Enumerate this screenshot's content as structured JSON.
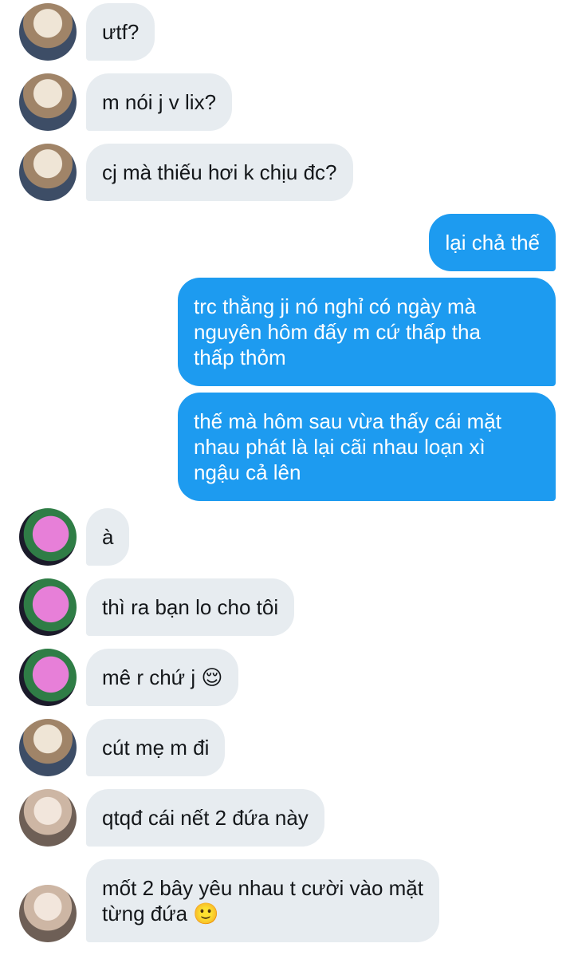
{
  "messages": [
    {
      "text": "ưtf?",
      "direction": "received",
      "sender_avatar": "avatar-a"
    },
    {
      "text": "m nói j v lix?",
      "direction": "received",
      "sender_avatar": "avatar-a"
    },
    {
      "text": "cj mà thiếu hơi k chịu đc?",
      "direction": "received",
      "sender_avatar": "avatar-a"
    },
    {
      "text": "lại chả thế",
      "direction": "sent"
    },
    {
      "text": "trc thằng ji nó nghỉ có ngày mà\nnguyên hôm đấy m cứ thấp tha\nthấp thỏm",
      "direction": "sent"
    },
    {
      "text": "thế mà hôm sau vừa thấy cái mặt\nnhau phát là lại cãi nhau loạn xì\nngậu cả lên",
      "direction": "sent"
    },
    {
      "text": "à",
      "direction": "received",
      "sender_avatar": "avatar-b"
    },
    {
      "text": "thì ra bạn lo cho tôi",
      "direction": "received",
      "sender_avatar": "avatar-b"
    },
    {
      "text": "mê r chứ j 😌",
      "direction": "received",
      "sender_avatar": "avatar-b"
    },
    {
      "text": "cút mẹ m đi",
      "direction": "received",
      "sender_avatar": "avatar-a"
    },
    {
      "text": "qtqđ cái nết 2 đứa này",
      "direction": "received",
      "sender_avatar": "avatar-c"
    },
    {
      "text": "mốt 2 bây yêu nhau t cười vào mặt\ntừng đứa 🙂",
      "direction": "received",
      "sender_avatar": "avatar-c"
    }
  ],
  "colors": {
    "received_bubble": "#e7ecf0",
    "sent_bubble": "#1d9bf0",
    "received_text": "#14171a",
    "sent_text": "#ffffff"
  }
}
